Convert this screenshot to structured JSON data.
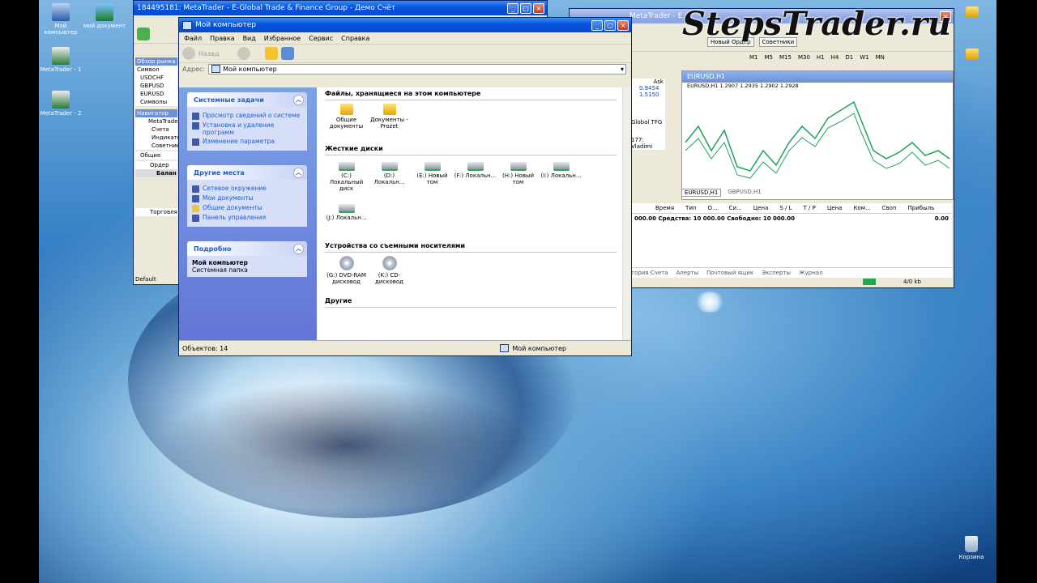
{
  "watermark": "StepsTrader.ru",
  "desktop": {
    "icons": [
      {
        "label": "Мой компьютер"
      },
      {
        "label": "мой документ"
      },
      {
        "label": "MetaTrader - 1"
      },
      {
        "label": "MetaTrader - 2"
      }
    ],
    "trash_label": "Корзина"
  },
  "mt_left": {
    "title": "184495181: MetaTrader - E-Global Trade & Finance Group - Демо Счёт",
    "market_watch_header": "Обзор рынка",
    "col_symbol": "Символ",
    "symbols": [
      "USDCHF",
      "GBPUSD",
      "EURUSD"
    ],
    "tab_symbols": "Символы",
    "navigator_header": "Навигатор",
    "nav_items": [
      "MetaTrader",
      "Счета",
      "Индикаторы",
      "Советники"
    ],
    "tab_common": "Общие",
    "terminal_cols": [
      "Ордер"
    ],
    "balance_label": "Балан",
    "trade_tab": "Торговля",
    "status": "Default"
  },
  "mt_right": {
    "title": "MetaTrader - E",
    "new_order": "Новый Ордер",
    "advisors": "Советники",
    "timeframes": [
      "M1",
      "M5",
      "M15",
      "M30",
      "H1",
      "H4",
      "D1",
      "W1",
      "MN"
    ],
    "ask_label": "Ask",
    "ask_values": [
      "0.9454",
      "1.5150"
    ],
    "chart_title": "EURUSD,H1",
    "chart_info": "EURUSD,H1  1.2907 1.2935 1.2902 1.2928",
    "nav_labels": [
      "Global TFG",
      "177: Vladimi"
    ],
    "chart_tabs": [
      "EURUSD,H1",
      "GBPUSD,H1"
    ],
    "terminal_cols": [
      "Время",
      "Тип",
      "О...",
      "Си...",
      "Цена",
      "S / L",
      "T / P",
      "Цена",
      "Ком...",
      "Своп",
      "Прибыль"
    ],
    "balance_line": "000.00  Средства: 10 000.00  Свободно: 10 000.00",
    "balance_total": "0.00",
    "bottom_tabs": [
      "тория Счета",
      "Алерты",
      "Почтовый ящик",
      "Эксперты",
      "Журнал"
    ],
    "traffic": "4/0 kb"
  },
  "explorer": {
    "title": "Мой компьютер",
    "menu": [
      "Файл",
      "Правка",
      "Вид",
      "Избранное",
      "Сервис",
      "Справка"
    ],
    "back_label": "Назад",
    "address_label": "Адрес:",
    "address_value": "Мой компьютер",
    "panels": [
      {
        "title": "Системные задачи",
        "items": [
          "Просмотр сведений о системе",
          "Установка и удаление программ",
          "Изменение параметра"
        ]
      },
      {
        "title": "Другие места",
        "items": [
          "Сетевое окружение",
          "Мои документы",
          "Общие документы",
          "Панель управления"
        ]
      },
      {
        "title": "Подробно",
        "detail_title": "Мой компьютер",
        "detail_sub": "Системная папка"
      }
    ],
    "sections": {
      "files": "Файлы, хранящиеся на этом компьютере",
      "hdd": "Жесткие диски",
      "removable": "Устройства со съемными носителями",
      "other": "Другие"
    },
    "file_items": [
      "Общие документы",
      "Документы - Prozet"
    ],
    "drives": [
      "(C:) Локальный диск",
      "(D:) Локальн...",
      "(E:) Новый том",
      "(F:) Локальн...",
      "(H:) Новый том",
      "(I:) Локальн...",
      "(J:) Локальн..."
    ],
    "removable_items": [
      "(G:) DVD-RAM дисковод",
      "(K:) CD-дисковод"
    ],
    "status_left": "Объектов: 14",
    "status_right": "Мой компьютер"
  }
}
